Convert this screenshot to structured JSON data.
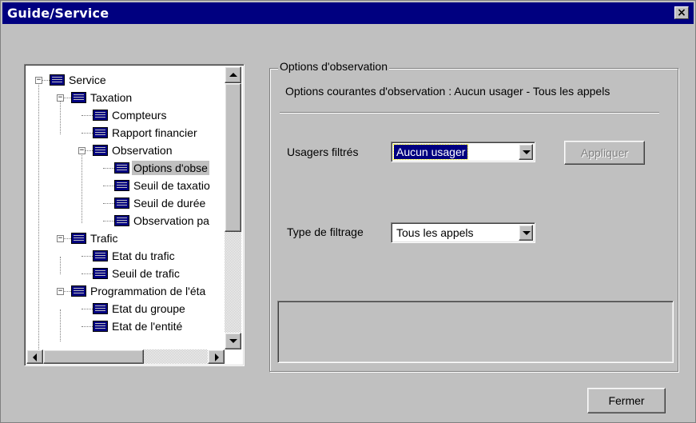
{
  "window": {
    "title": "Guide/Service",
    "close_glyph": "×"
  },
  "tree": {
    "items": [
      {
        "label": "Service",
        "expander": "−"
      },
      {
        "label": "Taxation",
        "expander": "−"
      },
      {
        "label": "Compteurs"
      },
      {
        "label": "Rapport financier"
      },
      {
        "label": "Observation",
        "expander": "−"
      },
      {
        "label": "Options d'obse",
        "selected": true
      },
      {
        "label": "Seuil de taxatio"
      },
      {
        "label": "Seuil de durée"
      },
      {
        "label": "Observation pa"
      },
      {
        "label": "Trafic",
        "expander": "−"
      },
      {
        "label": "Etat du trafic"
      },
      {
        "label": "Seuil de trafic"
      },
      {
        "label": "Programmation de l'éta",
        "expander": "−"
      },
      {
        "label": "Etat du groupe"
      },
      {
        "label": "Etat de l'entité"
      }
    ]
  },
  "group": {
    "legend": "Options d'observation",
    "current_options": "Options courantes d'observation : Aucun usager - Tous les appels",
    "users_label": "Usagers filtrés",
    "users_value": "Aucun usager",
    "apply_label": "Appliquer",
    "filter_type_label": "Type de filtrage",
    "filter_type_value": "Tous les appels"
  },
  "footer": {
    "close_label": "Fermer"
  },
  "colors": {
    "titlebar": "#000080",
    "face": "#c0c0c0",
    "selection": "#000080"
  }
}
